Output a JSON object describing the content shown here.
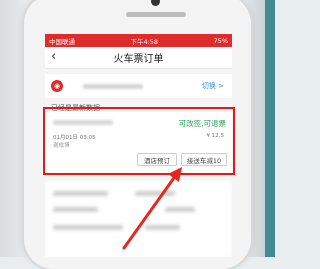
{
  "status_bar": {
    "carrier": "中国联通",
    "time": "下午4:58",
    "battery": "75%"
  },
  "nav": {
    "back_icon": "chevron-left-icon",
    "title": "火车票订单"
  },
  "account": {
    "icon": "train-logo-icon",
    "switch_label": "切换 >"
  },
  "list_header": "已经是最新数据",
  "order": {
    "status": "可改签,可退票",
    "date": "01月01日 03:05",
    "price": "¥ 12.5",
    "passenger": "谢成博",
    "buttons": {
      "hotel": "酒店预订",
      "transfer": "接送车减10"
    }
  },
  "colors": {
    "status_bar": "#e02b2b",
    "highlight": "#e81818",
    "status_text": "#29a35a",
    "link": "#3a8fd9"
  }
}
